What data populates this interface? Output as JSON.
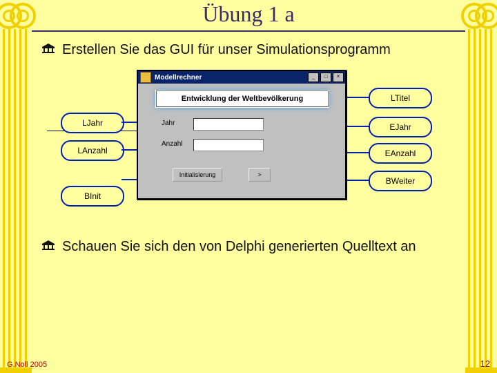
{
  "slide": {
    "title": "Übung 1 a",
    "bullets": [
      "Erstellen Sie das GUI für unser Simulationsprogramm",
      "Schauen Sie sich den von Delphi generierten Quelltext an"
    ]
  },
  "mockup": {
    "window_title": "Modellrechner",
    "panel_title": "Entwicklung der Weltbevölkerung",
    "labels": {
      "jahr": "Jahr",
      "anzahl": "Anzahl"
    },
    "buttons": {
      "init": "Initialisierung",
      "next": ">"
    }
  },
  "tags": {
    "LJahr": "LJahr",
    "LAnzahl": "LAnzahl",
    "BInit": "BInit",
    "LTitel": "LTitel",
    "EJahr": "EJahr",
    "EAnzahl": "EAnzahl",
    "BWeiter": "BWeiter"
  },
  "footer": {
    "author": "G.Noll 2005",
    "page": "12"
  }
}
